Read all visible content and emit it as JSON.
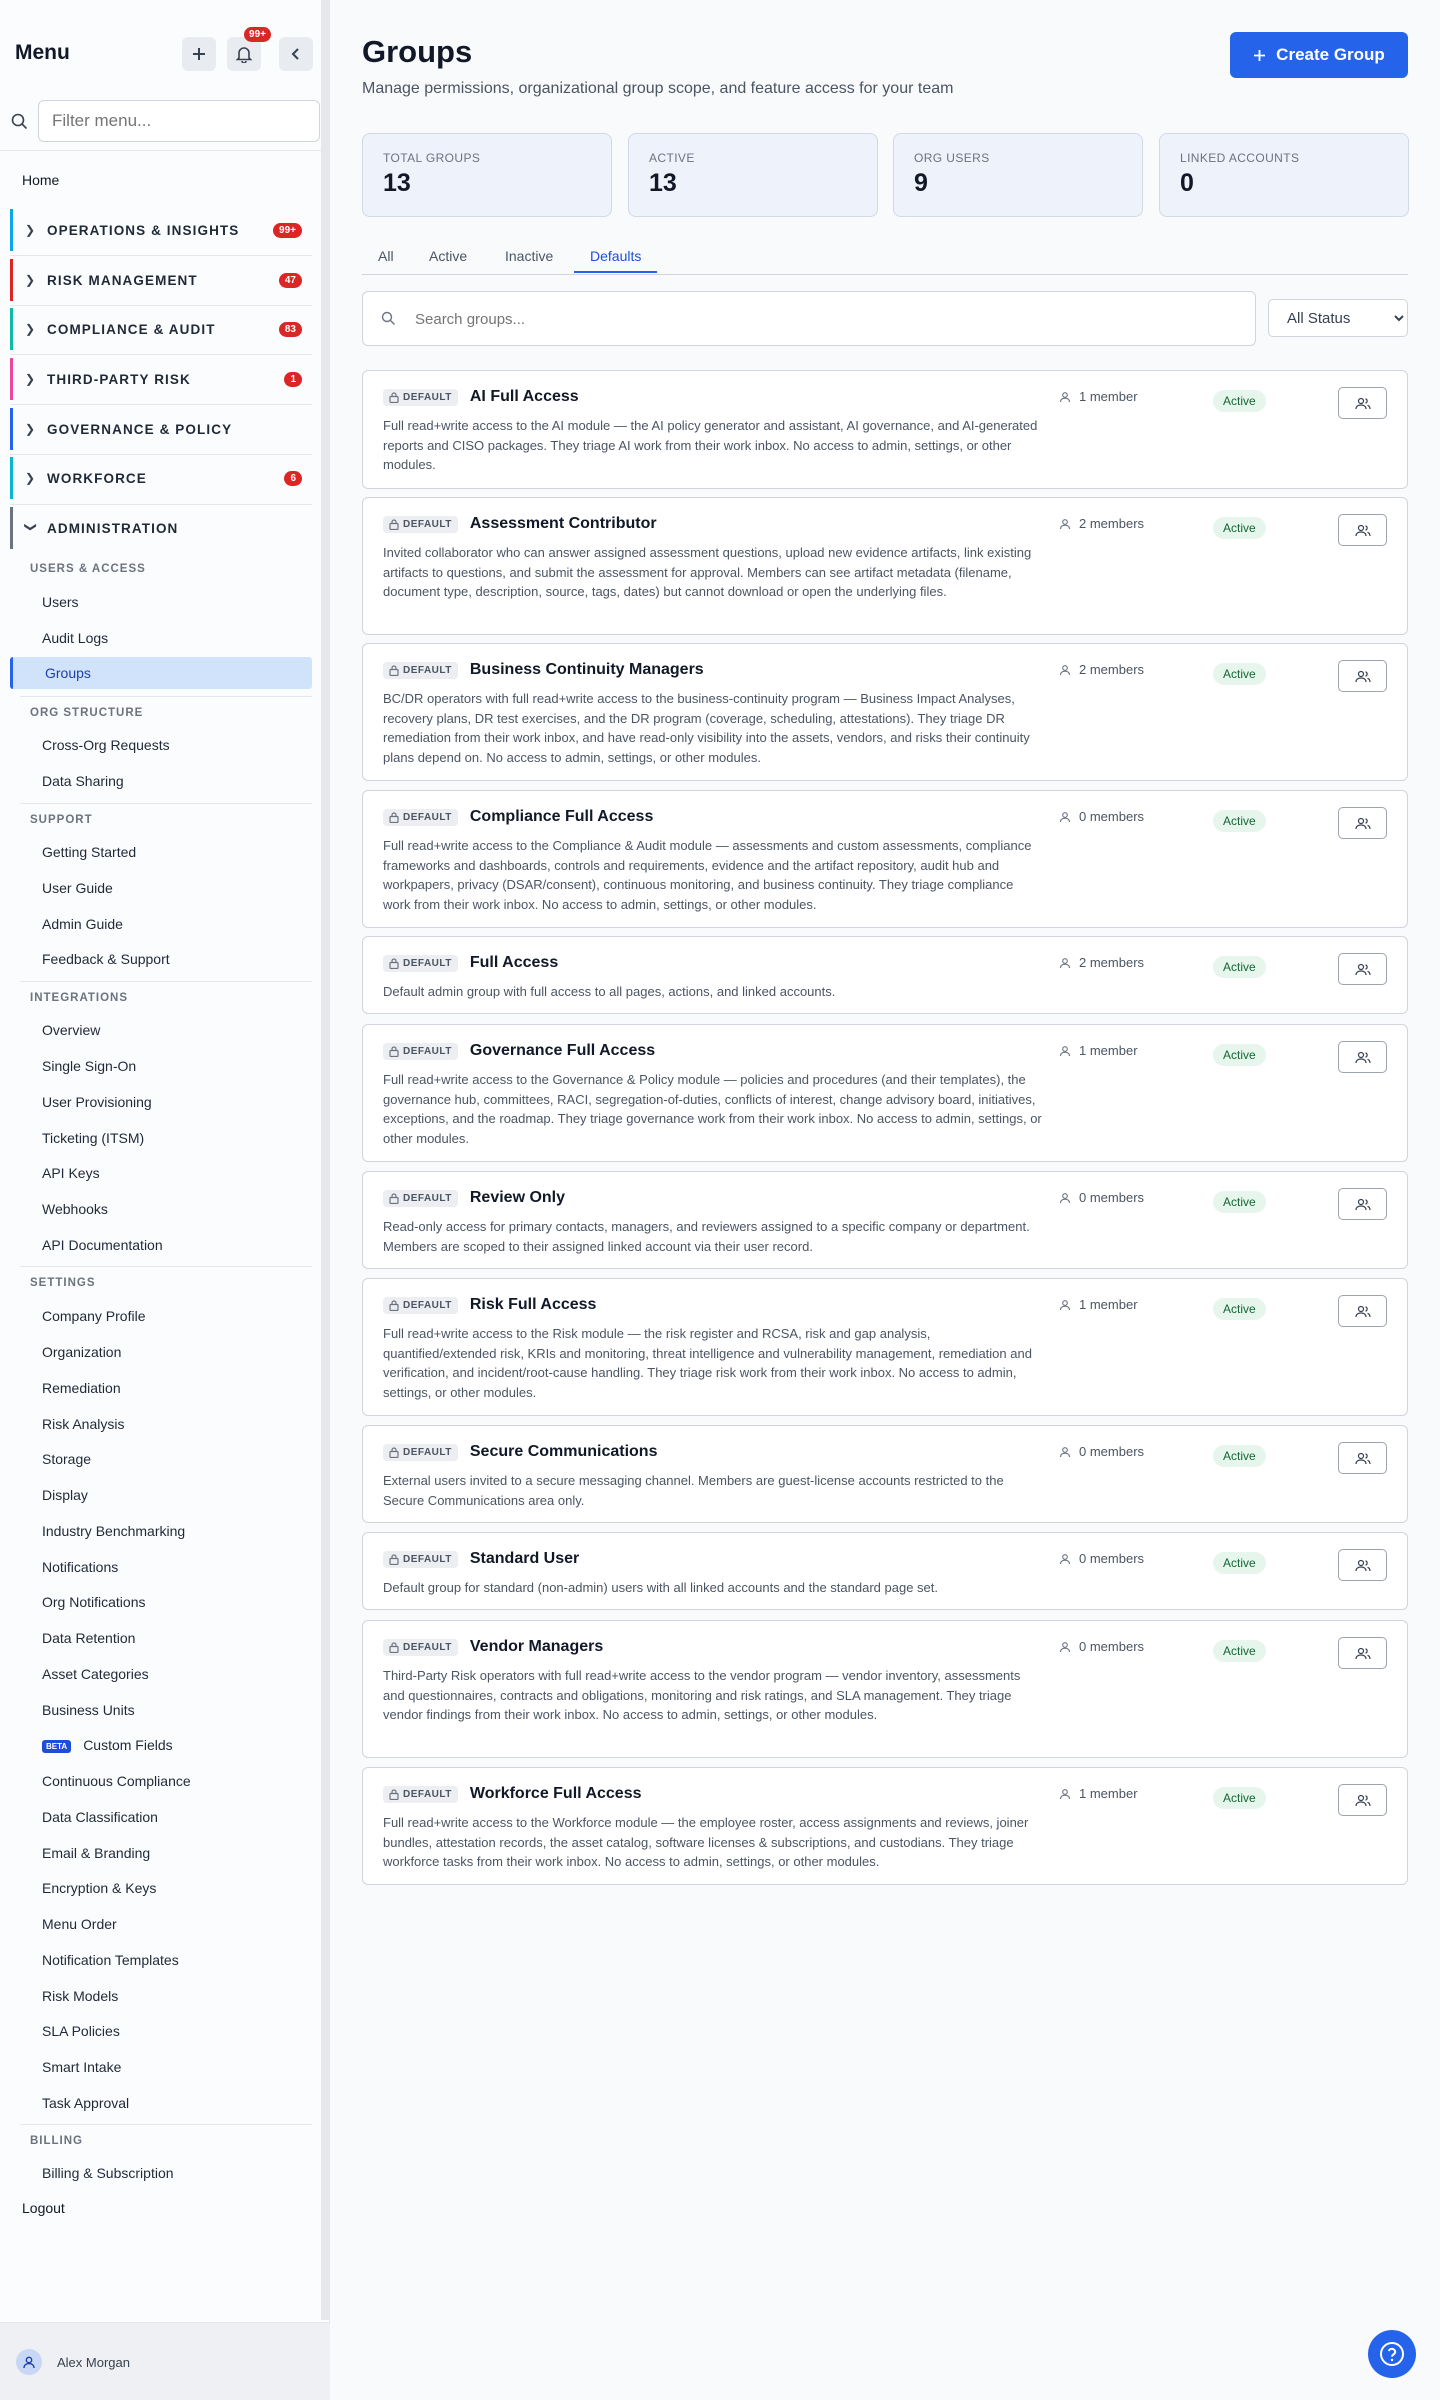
{
  "sidebar": {
    "title": "Menu",
    "notif_count": "99+",
    "filter_placeholder": "Filter menu...",
    "home": "Home",
    "groups": [
      {
        "label": "OPERATIONS & INSIGHTS",
        "badge": "99+",
        "color": "#0ea5e9"
      },
      {
        "label": "RISK MANAGEMENT",
        "badge": "47",
        "color": "#dc2626"
      },
      {
        "label": "COMPLIANCE & AUDIT",
        "badge": "83",
        "color": "#14b8a6"
      },
      {
        "label": "THIRD-PARTY RISK",
        "badge": "1",
        "color": "#ec4899"
      },
      {
        "label": "GOVERNANCE & POLICY",
        "badge": "",
        "color": "#2563eb"
      },
      {
        "label": "WORKFORCE",
        "badge": "6",
        "color": "#06b6d4"
      },
      {
        "label": "ADMINISTRATION",
        "badge": "",
        "color": "#6b7280"
      }
    ],
    "sections": {
      "users_access": {
        "heading": "USERS & ACCESS",
        "items": [
          "Users",
          "Audit Logs",
          "Groups"
        ]
      },
      "org_structure": {
        "heading": "ORG STRUCTURE",
        "items": [
          "Cross-Org Requests",
          "Data Sharing"
        ]
      },
      "support": {
        "heading": "SUPPORT",
        "items": [
          "Getting Started",
          "User Guide",
          "Admin Guide",
          "Feedback & Support"
        ]
      },
      "integrations": {
        "heading": "INTEGRATIONS",
        "items": [
          "Overview",
          "Single Sign-On",
          "User Provisioning",
          "Ticketing (ITSM)",
          "API Keys",
          "Webhooks",
          "API Documentation"
        ]
      },
      "settings": {
        "heading": "SETTINGS",
        "items": [
          "Company Profile",
          "Organization",
          "Remediation",
          "Risk Analysis",
          "Storage",
          "Display",
          "Industry Benchmarking",
          "Notifications",
          "Org Notifications",
          "Data Retention",
          "Asset Categories",
          "Business Units",
          "Custom Fields",
          "Continuous Compliance",
          "Data Classification",
          "Email & Branding",
          "Encryption & Keys",
          "Menu Order",
          "Notification Templates",
          "Risk Models",
          "SLA Policies",
          "Smart Intake",
          "Task Approval"
        ],
        "beta_label": "BETA"
      },
      "billing": {
        "heading": "BILLING",
        "items": [
          "Billing & Subscription"
        ]
      }
    },
    "logout": "Logout",
    "user_name": "Alex Morgan"
  },
  "main": {
    "title": "Groups",
    "subtitle": "Manage permissions, organizational group scope, and feature access for your team",
    "create_label": "Create Group",
    "stats": [
      {
        "label": "TOTAL GROUPS",
        "value": "13"
      },
      {
        "label": "ACTIVE",
        "value": "13"
      },
      {
        "label": "ORG USERS",
        "value": "9"
      },
      {
        "label": "LINKED ACCOUNTS",
        "value": "0"
      }
    ],
    "tabs": [
      "All",
      "Active",
      "Inactive",
      "Defaults"
    ],
    "active_tab": "Defaults",
    "search_placeholder": "Search groups...",
    "status_filter": "All Status",
    "default_label": "DEFAULT",
    "groups": [
      {
        "name": "AI Full Access",
        "desc": "Full read+write access to the AI module — the AI policy generator and assistant, AI governance, and AI-generated reports and CISO packages. They triage AI work from their work inbox. No access to admin, settings, or other modules.",
        "members": "1 member",
        "status": "Active"
      },
      {
        "name": "Assessment Contributor",
        "desc": "Invited collaborator who can answer assigned assessment questions, upload new evidence artifacts, link existing artifacts to questions, and submit the assessment for approval. Members can see artifact metadata (filename, document type, description, source, tags, dates) but cannot download or open the underlying files.",
        "members": "2 members",
        "status": "Active"
      },
      {
        "name": "Business Continuity Managers",
        "desc": "BC/DR operators with full read+write access to the business-continuity program — Business Impact Analyses, recovery plans, DR test exercises, and the DR program (coverage, scheduling, attestations). They triage DR remediation from their work inbox, and have read-only visibility into the assets, vendors, and risks their continuity plans depend on. No access to admin, settings, or other modules.",
        "members": "2 members",
        "status": "Active"
      },
      {
        "name": "Compliance Full Access",
        "desc": "Full read+write access to the Compliance & Audit module — assessments and custom assessments, compliance frameworks and dashboards, controls and requirements, evidence and the artifact repository, audit hub and workpapers, privacy (DSAR/consent), continuous monitoring, and business continuity. They triage compliance work from their work inbox. No access to admin, settings, or other modules.",
        "members": "0 members",
        "status": "Active"
      },
      {
        "name": "Full Access",
        "desc": "Default admin group with full access to all pages, actions, and linked accounts.",
        "members": "2 members",
        "status": "Active"
      },
      {
        "name": "Governance Full Access",
        "desc": "Full read+write access to the Governance & Policy module — policies and procedures (and their templates), the governance hub, committees, RACI, segregation-of-duties, conflicts of interest, change advisory board, initiatives, exceptions, and the roadmap. They triage governance work from their work inbox. No access to admin, settings, or other modules.",
        "members": "1 member",
        "status": "Active"
      },
      {
        "name": "Review Only",
        "desc": "Read-only access for primary contacts, managers, and reviewers assigned to a specific company or department. Members are scoped to their assigned linked account via their user record.",
        "members": "0 members",
        "status": "Active"
      },
      {
        "name": "Risk Full Access",
        "desc": "Full read+write access to the Risk module — the risk register and RCSA, risk and gap analysis, quantified/extended risk, KRIs and monitoring, threat intelligence and vulnerability management, remediation and verification, and incident/root-cause handling. They triage risk work from their work inbox. No access to admin, settings, or other modules.",
        "members": "1 member",
        "status": "Active"
      },
      {
        "name": "Secure Communications",
        "desc": "External users invited to a secure messaging channel. Members are guest-license accounts restricted to the Secure Communications area only.",
        "members": "0 members",
        "status": "Active"
      },
      {
        "name": "Standard User",
        "desc": "Default group for standard (non-admin) users with all linked accounts and the standard page set.",
        "members": "0 members",
        "status": "Active"
      },
      {
        "name": "Vendor Managers",
        "desc": "Third-Party Risk operators with full read+write access to the vendor program — vendor inventory, assessments and questionnaires, contracts and obligations, monitoring and risk ratings, and SLA management. They triage vendor findings from their work inbox. No access to admin, settings, or other modules.",
        "members": "0 members",
        "status": "Active"
      },
      {
        "name": "Workforce Full Access",
        "desc": "Full read+write access to the Workforce module — the employee roster, access assignments and reviews, joiner bundles, attestation records, the asset catalog, software licenses & subscriptions, and custodians. They triage workforce tasks from their work inbox. No access to admin, settings, or other modules.",
        "members": "1 member",
        "status": "Active"
      }
    ]
  },
  "colors": {
    "accent": "#2563eb",
    "danger": "#dc2626",
    "active_bg": "#e6f6ec"
  },
  "icons": {
    "add": "plus-icon",
    "notifications": "bell-icon",
    "collapse": "chevron-left-icon",
    "search": "search-icon",
    "lock": "lock-icon",
    "member": "user-icon",
    "manage": "users-icon",
    "help": "help-icon"
  }
}
